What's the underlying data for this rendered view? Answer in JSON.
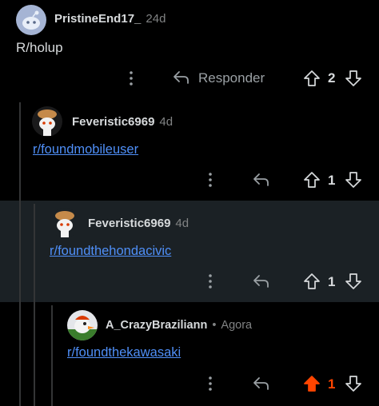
{
  "colors": {
    "background": "#000000",
    "highlight": "#1b2125",
    "link": "#4f8ff7",
    "upvoted": "#ff4500",
    "thread_line": "#343536"
  },
  "comments": [
    {
      "username": "PristineEnd17_",
      "time": "24d",
      "text": "R/holup",
      "reply_label": "Responder",
      "votes": "2",
      "upvoted": false,
      "avatar_icon": "snoo-avatar-icon"
    },
    {
      "username": "Feveristic6969",
      "time": "4d",
      "link": "r/foundmobileuser",
      "votes": "1",
      "upvoted": false,
      "avatar_icon": "snoo-avatar-icon"
    },
    {
      "username": "Feveristic6969",
      "time": "4d",
      "link": "r/foundthehondacivic",
      "votes": "1",
      "upvoted": false,
      "highlighted": true,
      "avatar_icon": "snoo-avatar-icon"
    },
    {
      "username": "A_CrazyBraziliann",
      "separator": "•",
      "time": "Agora",
      "link": "r/foundthekawasaki",
      "votes": "1",
      "upvoted": true,
      "avatar_icon": "bird-avatar-icon"
    }
  ]
}
